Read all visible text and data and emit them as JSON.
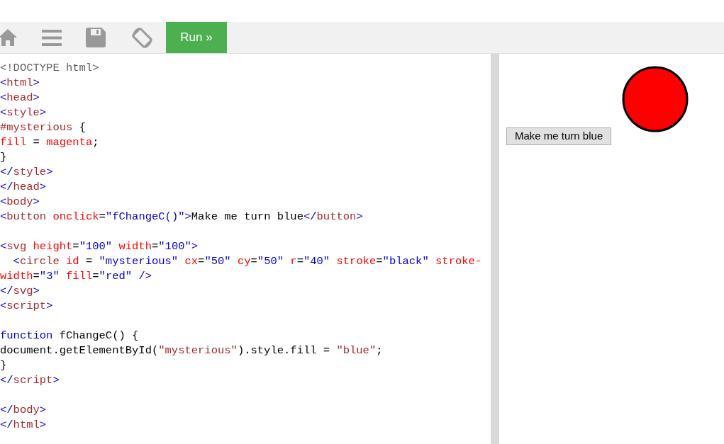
{
  "toolbar": {
    "run_button": "Run »"
  },
  "editor": {
    "lines": [
      {
        "kind": "code",
        "tokens": [
          {
            "t": "<!DOCTYPE html>",
            "kind": "doctype"
          }
        ]
      },
      {
        "kind": "code",
        "tokens": [
          {
            "t": "<",
            "kind": "punct"
          },
          {
            "t": "html",
            "kind": "tag"
          },
          {
            "t": ">",
            "kind": "punct"
          }
        ]
      },
      {
        "kind": "code",
        "tokens": [
          {
            "t": "<",
            "kind": "punct"
          },
          {
            "t": "head",
            "kind": "tag"
          },
          {
            "t": ">",
            "kind": "punct"
          }
        ]
      },
      {
        "kind": "code",
        "tokens": [
          {
            "t": "<",
            "kind": "punct"
          },
          {
            "t": "style",
            "kind": "tag"
          },
          {
            "t": ">",
            "kind": "punct"
          }
        ]
      },
      {
        "kind": "code",
        "tokens": [
          {
            "t": "#mysterious ",
            "kind": "sel"
          },
          {
            "t": "{",
            "kind": "text"
          }
        ]
      },
      {
        "kind": "code",
        "tokens": [
          {
            "t": "fill ",
            "kind": "prop"
          },
          {
            "t": "= ",
            "kind": "text"
          },
          {
            "t": "magenta",
            "kind": "prop"
          },
          {
            "t": ";",
            "kind": "text"
          }
        ]
      },
      {
        "kind": "code",
        "tokens": [
          {
            "t": "}",
            "kind": "text"
          }
        ]
      },
      {
        "kind": "code",
        "tokens": [
          {
            "t": "</",
            "kind": "punct"
          },
          {
            "t": "style",
            "kind": "tag"
          },
          {
            "t": ">",
            "kind": "punct"
          }
        ]
      },
      {
        "kind": "code",
        "tokens": [
          {
            "t": "</",
            "kind": "punct"
          },
          {
            "t": "head",
            "kind": "tag"
          },
          {
            "t": ">",
            "kind": "punct"
          }
        ]
      },
      {
        "kind": "code",
        "tokens": [
          {
            "t": "<",
            "kind": "punct"
          },
          {
            "t": "body",
            "kind": "tag"
          },
          {
            "t": ">",
            "kind": "punct"
          }
        ]
      },
      {
        "kind": "code",
        "tokens": [
          {
            "t": "<",
            "kind": "punct"
          },
          {
            "t": "button ",
            "kind": "tag"
          },
          {
            "t": "onclick",
            "kind": "attr"
          },
          {
            "t": "=",
            "kind": "text"
          },
          {
            "t": "\"fChangeC()\"",
            "kind": "val"
          },
          {
            "t": ">",
            "kind": "punct"
          },
          {
            "t": "Make me turn blue",
            "kind": "text"
          },
          {
            "t": "</",
            "kind": "punct"
          },
          {
            "t": "button",
            "kind": "tag"
          },
          {
            "t": ">",
            "kind": "punct"
          }
        ]
      },
      {
        "kind": "blank"
      },
      {
        "kind": "code",
        "tokens": [
          {
            "t": "<",
            "kind": "punct"
          },
          {
            "t": "svg ",
            "kind": "tag"
          },
          {
            "t": "height",
            "kind": "attr"
          },
          {
            "t": "=",
            "kind": "text"
          },
          {
            "t": "\"100\" ",
            "kind": "val"
          },
          {
            "t": "width",
            "kind": "attr"
          },
          {
            "t": "=",
            "kind": "text"
          },
          {
            "t": "\"100\"",
            "kind": "val"
          },
          {
            "t": ">",
            "kind": "punct"
          }
        ]
      },
      {
        "kind": "code",
        "tokens": [
          {
            "t": "  <",
            "kind": "punct"
          },
          {
            "t": "circle ",
            "kind": "tag"
          },
          {
            "t": "id ",
            "kind": "attr"
          },
          {
            "t": "= ",
            "kind": "text"
          },
          {
            "t": "\"mysterious\" ",
            "kind": "val"
          },
          {
            "t": "cx",
            "kind": "attr"
          },
          {
            "t": "=",
            "kind": "text"
          },
          {
            "t": "\"50\" ",
            "kind": "val"
          },
          {
            "t": "cy",
            "kind": "attr"
          },
          {
            "t": "=",
            "kind": "text"
          },
          {
            "t": "\"50\" ",
            "kind": "val"
          },
          {
            "t": "r",
            "kind": "attr"
          },
          {
            "t": "=",
            "kind": "text"
          },
          {
            "t": "\"40\" ",
            "kind": "val"
          },
          {
            "t": "stroke",
            "kind": "attr"
          },
          {
            "t": "=",
            "kind": "text"
          },
          {
            "t": "\"black\" ",
            "kind": "val"
          },
          {
            "t": "stroke-",
            "kind": "attr"
          }
        ]
      },
      {
        "kind": "code",
        "tokens": [
          {
            "t": "width",
            "kind": "attr"
          },
          {
            "t": "=",
            "kind": "text"
          },
          {
            "t": "\"3\" ",
            "kind": "val"
          },
          {
            "t": "fill",
            "kind": "attr"
          },
          {
            "t": "=",
            "kind": "text"
          },
          {
            "t": "\"red\" ",
            "kind": "val"
          },
          {
            "t": "/>",
            "kind": "punct"
          }
        ]
      },
      {
        "kind": "code",
        "tokens": [
          {
            "t": "</",
            "kind": "punct"
          },
          {
            "t": "svg",
            "kind": "tag"
          },
          {
            "t": ">",
            "kind": "punct"
          }
        ]
      },
      {
        "kind": "code",
        "tokens": [
          {
            "t": "<",
            "kind": "punct"
          },
          {
            "t": "script",
            "kind": "tag"
          },
          {
            "t": ">",
            "kind": "punct"
          }
        ]
      },
      {
        "kind": "blank"
      },
      {
        "kind": "code",
        "tokens": [
          {
            "t": "function ",
            "kind": "kw"
          },
          {
            "t": "fChangeC() {",
            "kind": "text"
          }
        ]
      },
      {
        "kind": "code",
        "tokens": [
          {
            "t": "document.getElementById(",
            "kind": "text"
          },
          {
            "t": "\"mysterious\"",
            "kind": "str"
          },
          {
            "t": ").style.fill = ",
            "kind": "text"
          },
          {
            "t": "\"blue\"",
            "kind": "str"
          },
          {
            "t": ";",
            "kind": "text"
          }
        ]
      },
      {
        "kind": "code",
        "tokens": [
          {
            "t": "}",
            "kind": "text"
          }
        ]
      },
      {
        "kind": "code",
        "tokens": [
          {
            "t": "</",
            "kind": "punct"
          },
          {
            "t": "script",
            "kind": "tag"
          },
          {
            "t": ">",
            "kind": "punct"
          }
        ]
      },
      {
        "kind": "blank"
      },
      {
        "kind": "code",
        "tokens": [
          {
            "t": "</",
            "kind": "punct"
          },
          {
            "t": "body",
            "kind": "tag"
          },
          {
            "t": ">",
            "kind": "punct"
          }
        ]
      },
      {
        "kind": "code",
        "tokens": [
          {
            "t": "</",
            "kind": "punct"
          },
          {
            "t": "html",
            "kind": "tag"
          },
          {
            "t": ">",
            "kind": "punct"
          }
        ]
      }
    ]
  },
  "preview": {
    "button": "Make me turn blue"
  }
}
